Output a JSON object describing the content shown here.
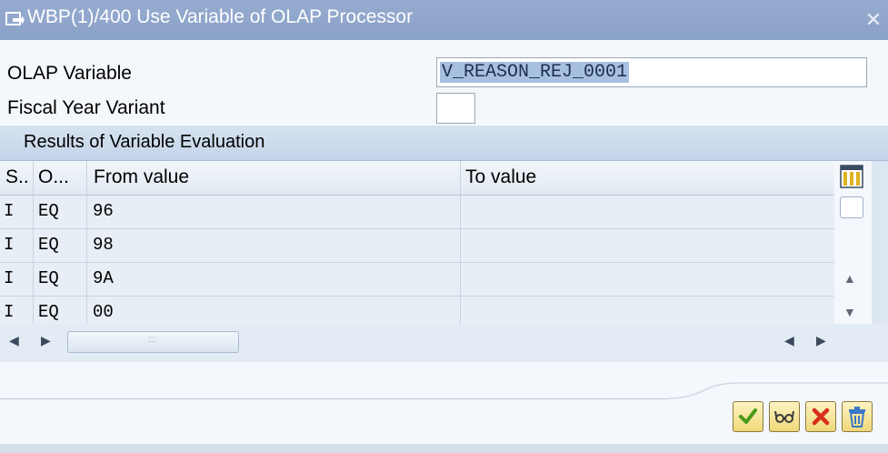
{
  "window": {
    "title": "WBP(1)/400 Use Variable of OLAP Processor",
    "close_glyph": "✕"
  },
  "form": {
    "olap_variable_label": "OLAP Variable",
    "olap_variable_value": "V_REASON_REJ_0001",
    "fiscal_year_variant_label": "Fiscal Year Variant",
    "fiscal_year_variant_value": ""
  },
  "results": {
    "title": "Results of Variable Evaluation",
    "columns": [
      "S..",
      "O...",
      "From value",
      "To value"
    ],
    "rows": [
      {
        "sign": "I",
        "option": "EQ",
        "from": "96",
        "to": ""
      },
      {
        "sign": "I",
        "option": "EQ",
        "from": "98",
        "to": ""
      },
      {
        "sign": "I",
        "option": "EQ",
        "from": "9A",
        "to": ""
      },
      {
        "sign": "I",
        "option": "EQ",
        "from": "00",
        "to": ""
      }
    ]
  },
  "buttons": {
    "continue": "check-icon",
    "display_keys": "glasses-icon",
    "cancel": "cross-icon",
    "delete": "trash-icon"
  },
  "colors": {
    "titlebar": "#8aa1c8",
    "selection": "#a8c0df",
    "button": "#f0d879",
    "check": "#4a9a1a",
    "cancel": "#d6301c",
    "delete": "#3a78c8"
  }
}
